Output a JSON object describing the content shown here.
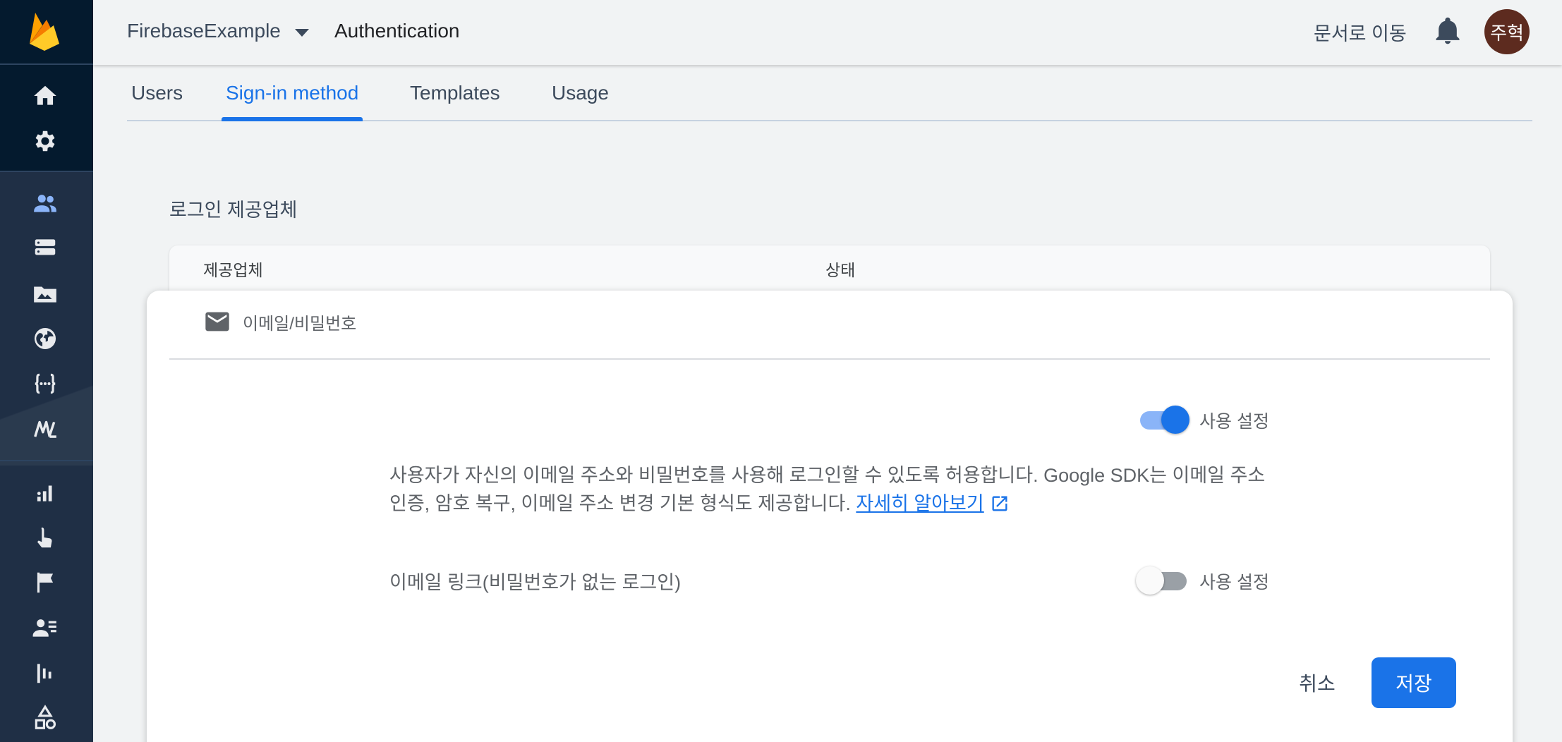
{
  "header": {
    "project_name": "FirebaseExample",
    "section_title": "Authentication",
    "docs_link": "문서로 이동",
    "avatar_initials": "주혁"
  },
  "tabs": [
    {
      "label": "Users",
      "active": false
    },
    {
      "label": "Sign-in method",
      "active": true
    },
    {
      "label": "Templates",
      "active": false
    },
    {
      "label": "Usage",
      "active": false
    }
  ],
  "providers": {
    "title": "로그인 제공업체",
    "columns": [
      "제공업체",
      "상태"
    ],
    "selected_provider": "이메일/비밀번호"
  },
  "email_password": {
    "enable_label": "사용 설정",
    "enabled": true,
    "description": "사용자가 자신의 이메일 주소와 비밀번호를 사용해 로그인할 수 있도록 허용합니다. Google SDK는 이메일 주소 인증, 암호 복구, 이메일 주소 변경 기본 형식도 제공합니다.",
    "learn_more": "자세히 알아보기",
    "email_link_label": "이메일 링크(비밀번호가 없는 로그인)",
    "email_link_enable_label": "사용 설정",
    "email_link_enabled": false
  },
  "actions": {
    "cancel": "취소",
    "save": "저장"
  },
  "colors": {
    "accent": "#1a73e8",
    "sidebar": "#1f2f45",
    "avatar": "#5d2b1f"
  },
  "sidebar_icons": [
    "firebase-logo",
    "home-icon",
    "settings-icon",
    "users-icon",
    "database-icon",
    "storage-icon",
    "hosting-icon",
    "functions-icon",
    "ml-icon",
    "analytics-icon",
    "engagement-icon",
    "flag-icon",
    "audience-icon",
    "streams-icon",
    "extensions-icon"
  ]
}
